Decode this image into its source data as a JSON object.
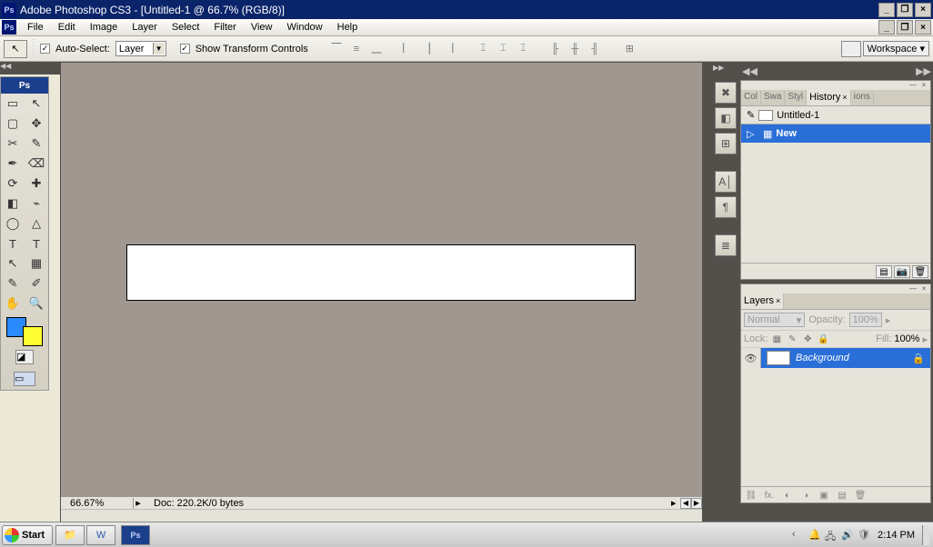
{
  "titlebar": {
    "ps_label": "Ps",
    "title": "Adobe Photoshop CS3 - [Untitled-1 @ 66.7% (RGB/8)]",
    "minimize": "_",
    "restore": "❐",
    "close": "×"
  },
  "menubar": {
    "items": [
      "File",
      "Edit",
      "Image",
      "Layer",
      "Select",
      "Filter",
      "View",
      "Window",
      "Help"
    ],
    "inner_minimize": "_",
    "inner_restore": "❐",
    "inner_close": "×"
  },
  "options": {
    "tool_glyph": "↖",
    "autoselect_label": "Auto-Select:",
    "autoselect_checked": "✓",
    "autoselect_value": "Layer",
    "transform_checked": "✓",
    "transform_label": "Show Transform Controls",
    "workspace_label": "Workspace ▾"
  },
  "toolbox": {
    "header": "Ps",
    "tools": [
      "▭",
      "↖",
      "▢",
      "✥",
      "✂",
      "✎",
      "✒",
      "⌫",
      "⟳",
      "✚",
      "◧",
      "⌁",
      "◯",
      "△",
      "T",
      "↖",
      "▦",
      "✎",
      "✋",
      "🔍"
    ]
  },
  "status": {
    "zoom": "66.67%",
    "doc": "Doc: 220.2K/0 bytes"
  },
  "right_tabs": {
    "history_group": [
      "Col",
      "Swa",
      "Styl",
      "History",
      "ions"
    ],
    "history_title": "Untitled-1",
    "history_entry": "New",
    "layers_tab": "Layers",
    "blend": "Normal",
    "opacity_label": "Opacity:",
    "opacity_val": "100%",
    "lock_label": "Lock:",
    "fill_label": "Fill:",
    "fill_val": "100%",
    "layer_name": "Background"
  },
  "taskbar": {
    "start": "Start",
    "clock": "2:14 PM"
  }
}
